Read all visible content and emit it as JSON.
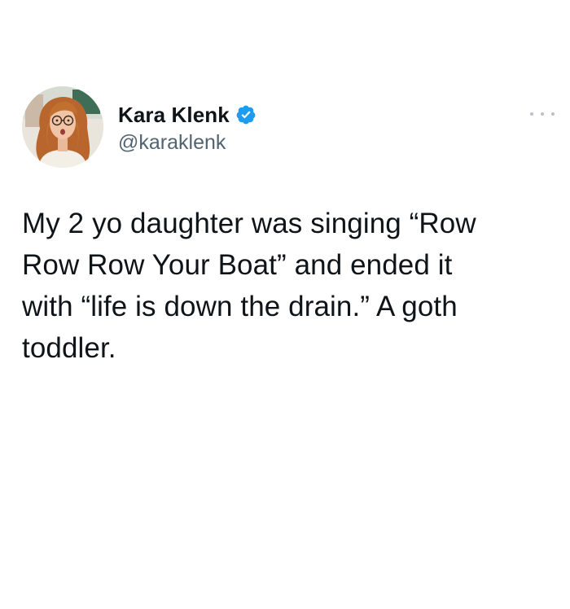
{
  "author": {
    "display_name": "Kara Klenk",
    "handle": "@karaklenk",
    "verified": true,
    "avatar_icon": "profile-photo-avatar",
    "verified_icon": "verified-badge-icon"
  },
  "menu": {
    "icon": "more-options-icon"
  },
  "tweet": {
    "text": "My 2 yo daughter was singing “Row\nRow Row Your Boat” and ended it\nwith “life is down the drain.” A goth\ntoddler."
  },
  "colors": {
    "text": "#0f1419",
    "handle": "#536471",
    "verified_blue": "#1d9bf0",
    "menu_dots": "#b7c0c8",
    "background": "#ffffff"
  }
}
